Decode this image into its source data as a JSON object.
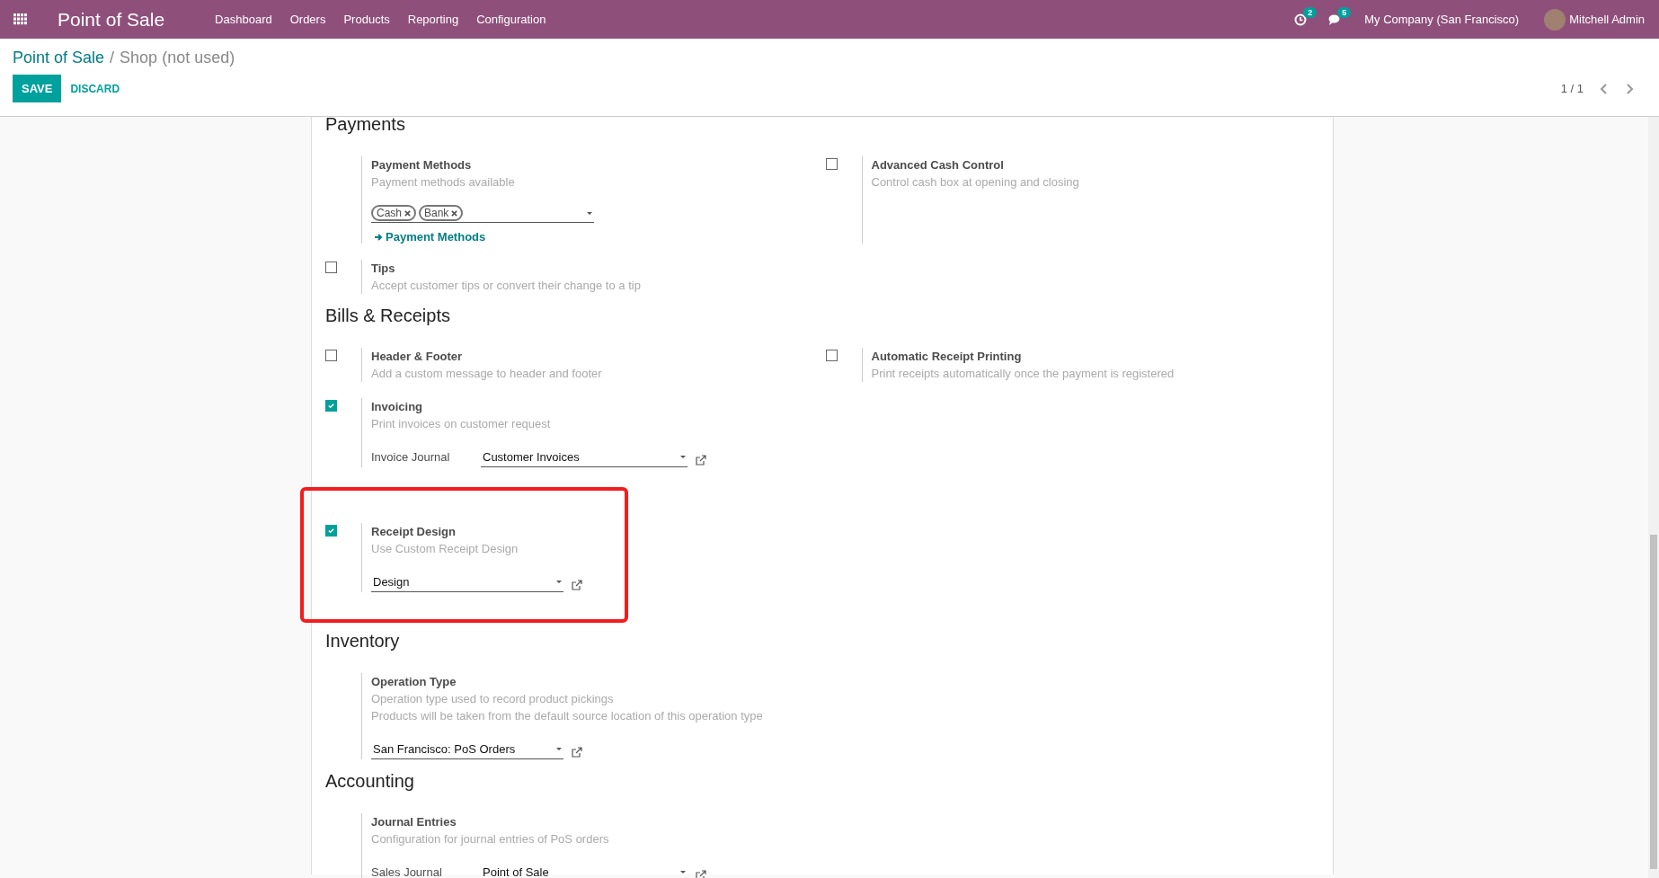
{
  "navbar": {
    "app_title": "Point of Sale",
    "menu": [
      "Dashboard",
      "Orders",
      "Products",
      "Reporting",
      "Configuration"
    ],
    "activity_count": "2",
    "message_count": "5",
    "company": "My Company (San Francisco)",
    "user": "Mitchell Admin"
  },
  "breadcrumb": {
    "parent": "Point of Sale",
    "separator": "/",
    "current": "Shop (not used)"
  },
  "buttons": {
    "save": "SAVE",
    "discard": "DISCARD"
  },
  "pager": {
    "value": "1 / 1"
  },
  "sections": [
    {
      "title": "Payments",
      "rows": [
        [
          {
            "kind": "plain",
            "label": "Payment Methods",
            "descriptions": [
              "Payment methods available"
            ],
            "highlighted": false,
            "field": {
              "kind": "tags",
              "tags": [
                "Cash",
                "Bank"
              ],
              "link": "Payment Methods"
            }
          },
          {
            "kind": "checkbox",
            "checked": false,
            "label": "Advanced Cash Control",
            "descriptions": [
              "Control cash box at opening and closing"
            ],
            "highlighted": false
          }
        ],
        [
          {
            "kind": "checkbox",
            "checked": false,
            "label": "Tips",
            "descriptions": [
              "Accept customer tips or convert their change to a tip"
            ],
            "highlighted": false
          }
        ]
      ]
    },
    {
      "title": "Bills & Receipts",
      "rows": [
        [
          {
            "kind": "checkbox",
            "checked": false,
            "label": "Header & Footer",
            "descriptions": [
              "Add a custom message to header and footer"
            ],
            "highlighted": false
          },
          {
            "kind": "checkbox",
            "checked": false,
            "label": "Automatic Receipt Printing",
            "descriptions": [
              "Print receipts automatically once the payment is registered"
            ],
            "highlighted": false
          }
        ],
        [
          {
            "kind": "checkbox",
            "checked": true,
            "label": "Invoicing",
            "descriptions": [
              "Print invoices on customer request"
            ],
            "highlighted": false,
            "field": {
              "kind": "select",
              "label": "Invoice Journal",
              "value": "Customer Invoices"
            }
          }
        ],
        [
          {
            "kind": "checkbox",
            "checked": true,
            "label": "Receipt Design",
            "descriptions": [
              "Use Custom Receipt Design"
            ],
            "highlighted": true,
            "field": {
              "kind": "select",
              "value": "Design"
            }
          }
        ]
      ]
    },
    {
      "title": "Inventory",
      "rows": [
        [
          {
            "kind": "plain",
            "label": "Operation Type",
            "descriptions": [
              "Operation type used to record product pickings",
              "Products will be taken from the default source location of this operation type"
            ],
            "highlighted": false,
            "field": {
              "kind": "select",
              "value": "San Francisco: PoS Orders"
            }
          }
        ]
      ]
    },
    {
      "title": "Accounting",
      "rows": [
        [
          {
            "kind": "plain",
            "label": "Journal Entries",
            "descriptions": [
              "Configuration for journal entries of PoS orders"
            ],
            "highlighted": false,
            "field": {
              "kind": "select",
              "label": "Sales Journal",
              "value": "Point of Sale"
            }
          }
        ]
      ]
    }
  ]
}
